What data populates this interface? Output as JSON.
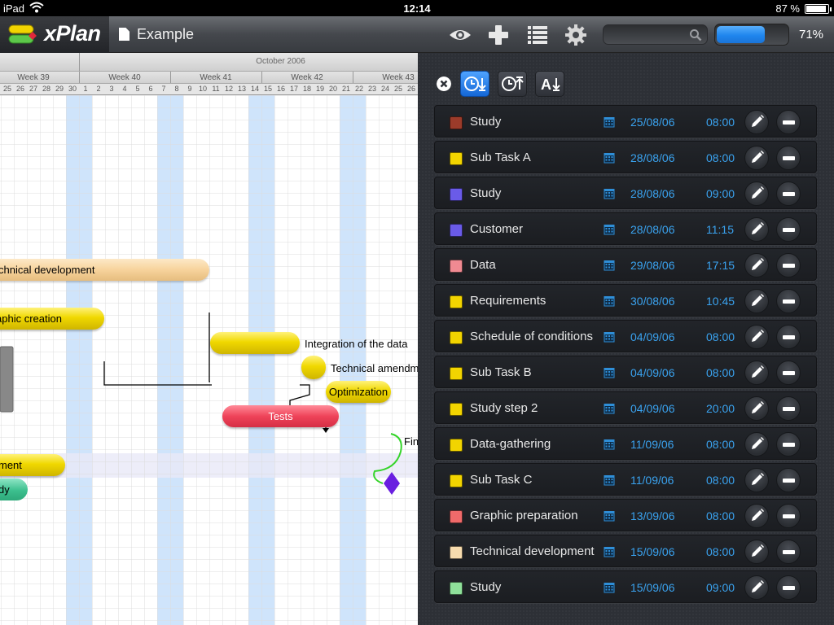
{
  "statusbar": {
    "device": "iPad",
    "time": "12:14",
    "battery": "87 %"
  },
  "toolbar": {
    "app_name": "xPlan",
    "document_title": "Example",
    "progress_percent": 71,
    "progress_label": "71%",
    "icons": [
      "eye-icon",
      "plus-icon",
      "list-icon",
      "gear-icon",
      "search-icon"
    ]
  },
  "gantt": {
    "month": "October 2006",
    "weeks": [
      "Week 39",
      "Week 40",
      "Week 41",
      "Week 42",
      "Week 43"
    ],
    "days": [
      "25",
      "26",
      "27",
      "28",
      "29",
      "30",
      "1",
      "2",
      "3",
      "4",
      "5",
      "6",
      "7",
      "8",
      "9",
      "10",
      "11",
      "12",
      "13",
      "14",
      "15",
      "16",
      "17",
      "18",
      "19",
      "20",
      "21",
      "22",
      "23",
      "24",
      "25",
      "26"
    ],
    "bars": {
      "technical_development": "chnical development",
      "graphic_creation": "aphic creation",
      "integration": "Integration of the data",
      "technical_amendment": "Technical amendm",
      "optimization": "Optimization",
      "tests": "Tests",
      "finish": "Fin",
      "yellow_bottom": "ment",
      "green_bottom": "dy"
    }
  },
  "panel": {
    "toolbar_buttons": [
      "close-icon",
      "sort-time-desc-icon",
      "sort-time-asc-icon",
      "sort-alpha-icon"
    ],
    "tasks": [
      {
        "name": "Study",
        "color": "#9b3b2a",
        "date": "25/08/06",
        "time": "08:00"
      },
      {
        "name": "Sub Task A",
        "color": "#f2d400",
        "date": "28/08/06",
        "time": "08:00"
      },
      {
        "name": "Study",
        "color": "#6a5be8",
        "date": "28/08/06",
        "time": "09:00"
      },
      {
        "name": "Customer",
        "color": "#6a5be8",
        "date": "28/08/06",
        "time": "11:15"
      },
      {
        "name": "Data",
        "color": "#f08a92",
        "date": "29/08/06",
        "time": "17:15"
      },
      {
        "name": "Requirements",
        "color": "#f2d400",
        "date": "30/08/06",
        "time": "10:45"
      },
      {
        "name": "Schedule of conditions",
        "color": "#f2d400",
        "date": "04/09/06",
        "time": "08:00"
      },
      {
        "name": "Sub Task B",
        "color": "#f2d400",
        "date": "04/09/06",
        "time": "08:00"
      },
      {
        "name": "Study step 2",
        "color": "#f2d400",
        "date": "04/09/06",
        "time": "20:00"
      },
      {
        "name": "Data-gathering",
        "color": "#f2d400",
        "date": "11/09/06",
        "time": "08:00"
      },
      {
        "name": "Sub Task C",
        "color": "#f2d400",
        "date": "11/09/06",
        "time": "08:00"
      },
      {
        "name": "Graphic preparation",
        "color": "#f06a6a",
        "date": "13/09/06",
        "time": "08:00"
      },
      {
        "name": "Technical development",
        "color": "#f7dcae",
        "date": "15/09/06",
        "time": "08:00"
      },
      {
        "name": "Study",
        "color": "#8fe09a",
        "date": "15/09/06",
        "time": "09:00"
      }
    ]
  }
}
